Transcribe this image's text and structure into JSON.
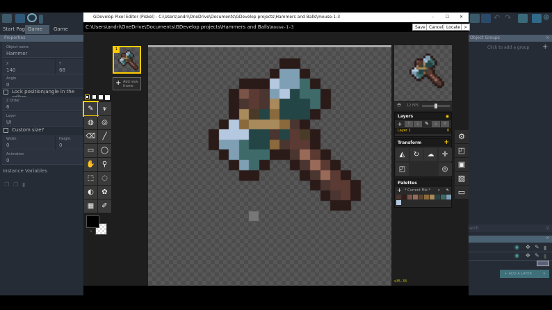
{
  "gdevelop": {
    "tabs": [
      "Start Page",
      "Game",
      "Game (Events)"
    ],
    "properties": {
      "header": "Properties",
      "object_name_label": "Object name",
      "object_name": "Hammer",
      "x_label": "X",
      "x": "140",
      "y_label": "Y",
      "y": "68",
      "angle_label": "Angle",
      "angle": "0",
      "lock_label": "Lock position/angle in the editor",
      "zorder_label": "Z Order",
      "zorder": "6",
      "layer_label": "Layer",
      "layer": "UI",
      "custom_size_label": "Custom size?",
      "width_label": "Width",
      "width": "0",
      "height_label": "Height",
      "height": "0",
      "animation_label": "Animation",
      "animation": "0",
      "instance_variables": "Instance Variables"
    },
    "object_groups": {
      "header": "Object Groups",
      "hint": "Click to add a group"
    },
    "search_placeholder": "Search",
    "add_layer": "ADD A LAYER"
  },
  "piskel": {
    "title": "GDevelop Pixel Editor (Piskel) - C:\\Users\\andri\\OneDrive\\Documents\\GDevelop projects\\Hammers and Balls\\mouse-1-3",
    "path": "C:\\Users\\andri\\OneDrive\\Documents\\GDevelop projects\\Hammers and Balls\\",
    "file": "mouse-1-3",
    "buttons": {
      "save": "Save",
      "cancel": "Cancel",
      "locate": "Locate",
      "more": ">"
    },
    "frame_number": "1",
    "add_frame": "Add new frame",
    "fps": "12 FPS",
    "fps_value": 12,
    "layers": {
      "title": "Layers",
      "active": "Layer 1",
      "opacity": "0"
    },
    "transform": {
      "title": "Transform"
    },
    "palettes": {
      "title": "Palettes",
      "current": "* Current File *",
      "colors": [
        "#4a3530",
        "#2e1e1c",
        "#7a5448",
        "#9a6a58",
        "#5a4632",
        "#8a6a3c",
        "#a88a5c",
        "#234545",
        "#3f6a6a",
        "#7f9fb4",
        "#b4c8e0"
      ]
    },
    "zoom": "x35.33",
    "primary_color": "#000000"
  }
}
